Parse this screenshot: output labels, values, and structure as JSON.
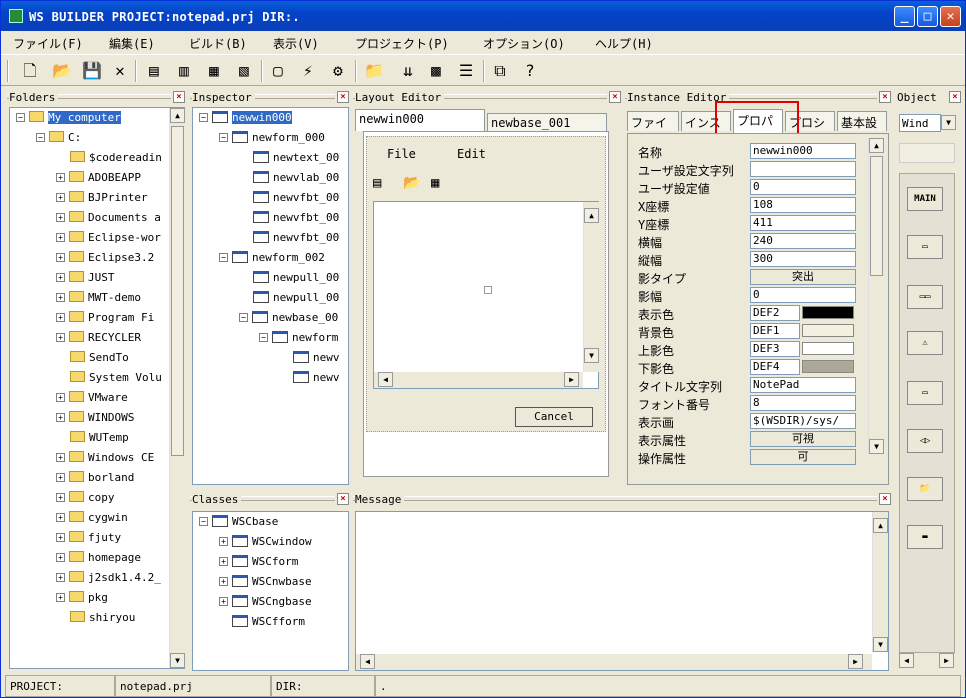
{
  "window": {
    "title": "WS BUILDER PROJECT:notepad.prj DIR:."
  },
  "menu": [
    "ファイル(F)",
    "編集(E)",
    "ビルド(B)",
    "表示(V)",
    "プロジェクト(P)",
    "オプション(O)",
    "ヘルプ(H)"
  ],
  "panes": {
    "folders": "Folders",
    "inspector": "Inspector",
    "layout": "Layout Editor",
    "instance": "Instance Editor",
    "object": "Object",
    "classes": "Classes",
    "message": "Message"
  },
  "folders": [
    "My computer",
    "C:",
    "$codereadin",
    "ADOBEAPP",
    "BJPrinter",
    "Documents a",
    "Eclipse-wor",
    "Eclipse3.2",
    "JUST",
    "MWT-demo",
    "Program Fi",
    "RECYCLER",
    "SendTo",
    "System Volu",
    "VMware",
    "WINDOWS",
    "WUTemp",
    "Windows CE",
    "borland",
    "copy",
    "cygwin",
    "fjuty",
    "homepage",
    "j2sdk1.4.2_",
    "pkg",
    "shiryou"
  ],
  "inspector": [
    "newwin000",
    "newform_000",
    "newtext_00",
    "newvlab_00",
    "newvfbt_00",
    "newvfbt_00",
    "newvfbt_00",
    "newform_002",
    "newpull_00",
    "newpull_00",
    "newbase_00",
    "newform",
    "newv",
    "newv"
  ],
  "layout": {
    "tabs": [
      "newwin000",
      "newbase_001"
    ],
    "menu_file": "File",
    "menu_edit": "Edit",
    "cancel": "Cancel"
  },
  "instance": {
    "tabs": [
      "ファイ",
      "インス",
      "プロパ",
      "プロシ",
      "基本設"
    ],
    "props": [
      {
        "k": "名称",
        "v": "newwin000"
      },
      {
        "k": "ユーザ設定文字列",
        "v": ""
      },
      {
        "k": "ユーザ設定値",
        "v": "0"
      },
      {
        "k": "X座標",
        "v": "108"
      },
      {
        "k": "Y座標",
        "v": "411"
      },
      {
        "k": "横幅",
        "v": "240"
      },
      {
        "k": "縦幅",
        "v": "300"
      },
      {
        "k": "影タイプ",
        "v": "突出"
      },
      {
        "k": "影幅",
        "v": "0"
      },
      {
        "k": "表示色",
        "v": "DEF2"
      },
      {
        "k": "背景色",
        "v": "DEF1"
      },
      {
        "k": "上影色",
        "v": "DEF3"
      },
      {
        "k": "下影色",
        "v": "DEF4"
      },
      {
        "k": "タイトル文字列",
        "v": "NotePad"
      },
      {
        "k": "フォント番号",
        "v": "8"
      },
      {
        "k": "表示画",
        "v": "$(WSDIR)/sys/"
      },
      {
        "k": "表示属性",
        "v": "可視"
      },
      {
        "k": "操作属性",
        "v": "可"
      }
    ]
  },
  "object": {
    "select": "Wind",
    "items": [
      "MAIN"
    ]
  },
  "classes": [
    "WSCbase",
    "WSCwindow",
    "WSCform",
    "WSCnwbase",
    "WSCngbase",
    "WSCfform"
  ],
  "status": {
    "project_label": "PROJECT:",
    "project": "notepad.prj",
    "dir_label": "DIR:",
    "dir": "."
  },
  "colors": {
    "titlebar": "#0343c9",
    "selection": "#316ac5",
    "highlight_box": "#e00000"
  }
}
